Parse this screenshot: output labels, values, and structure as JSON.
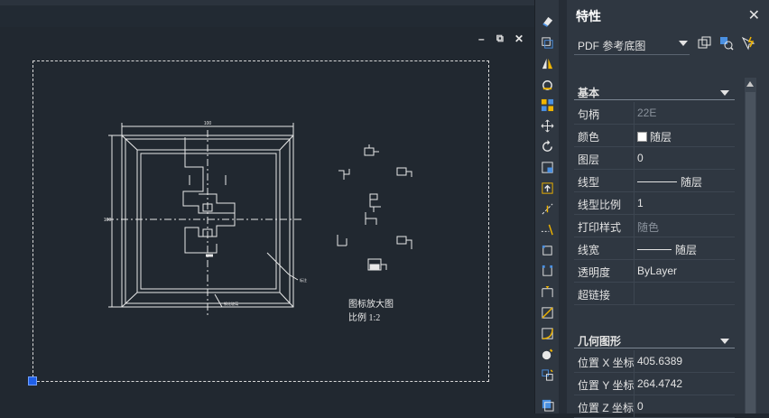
{
  "window_controls": {
    "minimize": "–",
    "restore": "⧉",
    "close": "✕"
  },
  "drawing": {
    "note_line1": "图标放大图",
    "note_line2": "比例 1:2",
    "top_dim": "100",
    "side_dim": "100",
    "leader_label": "标注",
    "bottom_leader_label": "钢化玻璃"
  },
  "toolbar": {
    "icons": [
      "eraser-icon",
      "copy-icon",
      "mirror-icon",
      "offset-icon",
      "array-icon",
      "move-icon",
      "rotate-icon",
      "scale-icon",
      "stretch-icon",
      "trim-icon",
      "extend-icon",
      "break-at-point-icon",
      "break-icon",
      "join-icon",
      "chamfer-icon",
      "fillet-icon",
      "explode-icon",
      "blend-icon",
      "overkill-icon"
    ]
  },
  "panel": {
    "title": "特性",
    "close": "✕",
    "selection": "PDF 参考底图",
    "sections": {
      "general": "基本",
      "geometry": "几何图形"
    },
    "general_rows": [
      {
        "key": "句柄",
        "value": "22E",
        "dim": true
      },
      {
        "key": "颜色",
        "value": "随层"
      },
      {
        "key": "图层",
        "value": "0"
      },
      {
        "key": "线型",
        "value": "随层"
      },
      {
        "key": "线型比例",
        "value": "1"
      },
      {
        "key": "打印样式",
        "value": "随色",
        "dim": true
      },
      {
        "key": "线宽",
        "value": "随层"
      },
      {
        "key": "透明度",
        "value": "ByLayer"
      },
      {
        "key": "超链接",
        "value": ""
      }
    ],
    "geometry_rows": [
      {
        "key": "位置 X 坐标",
        "value": "405.6389"
      },
      {
        "key": "位置 Y 坐标",
        "value": "264.4742"
      },
      {
        "key": "位置 Z 坐标",
        "value": "0"
      }
    ]
  },
  "colors": {
    "canvas": "#212830",
    "panel": "#2f3741",
    "grip": "#1f5fe8"
  }
}
